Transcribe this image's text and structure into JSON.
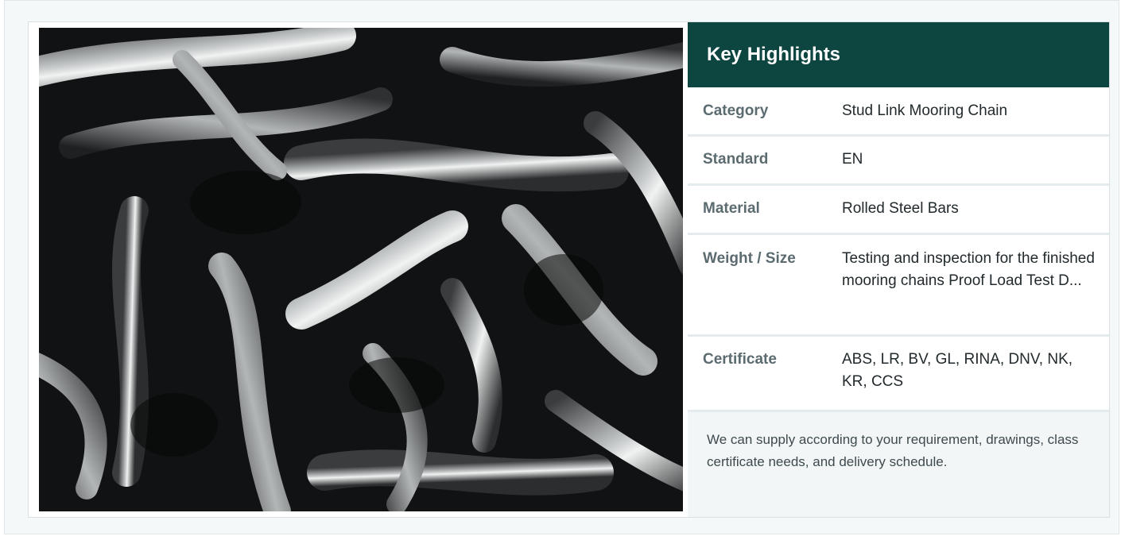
{
  "highlights": {
    "title": "Key Highlights",
    "rows": [
      {
        "label": "Category",
        "value": "Stud Link Mooring Chain"
      },
      {
        "label": "Standard",
        "value": "EN"
      },
      {
        "label": "Material",
        "value": "Rolled Steel Bars"
      },
      {
        "label": "Weight / Size",
        "value": "Testing and inspection for the finished mooring chains Proof Load Test D..."
      },
      {
        "label": "Certificate",
        "value": "ABS, LR, BV, GL, RINA, DNV, NK, KR, CCS"
      }
    ],
    "note": "We can supply according to your requirement, drawings, class certificate needs, and delivery schedule."
  },
  "colors": {
    "header_bg": "#0d4541",
    "label_text": "#5b6b70",
    "note_bg": "#f2f6f7"
  }
}
